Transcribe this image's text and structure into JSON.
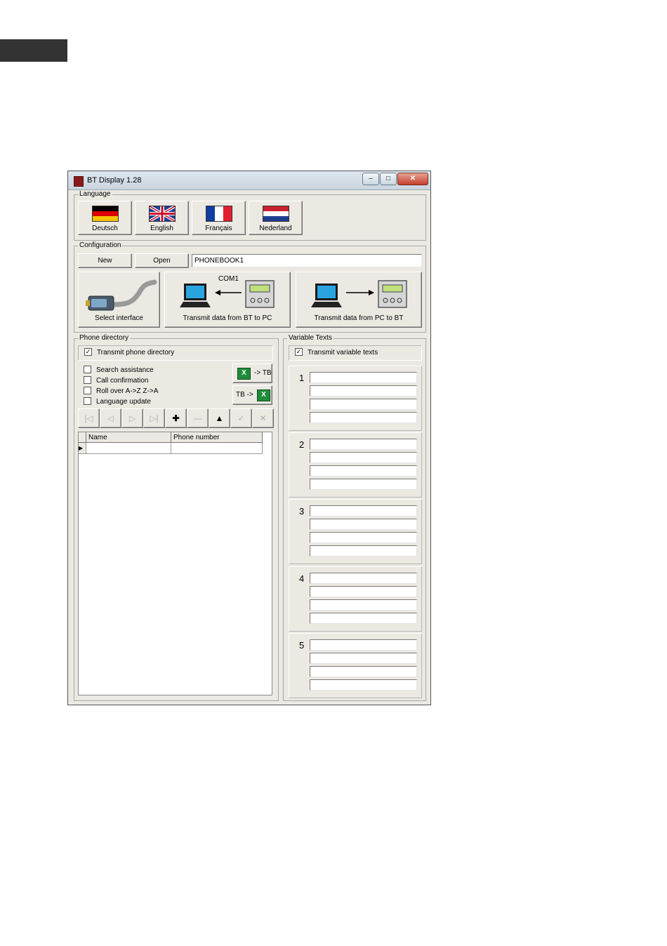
{
  "window": {
    "title": "BT Display 1.28"
  },
  "language": {
    "label": "Language",
    "buttons": [
      {
        "label": "Deutsch",
        "flag": "germany-flag"
      },
      {
        "label": "English",
        "flag": "uk-flag"
      },
      {
        "label": "Français",
        "flag": "france-flag"
      },
      {
        "label": "Nederland",
        "flag": "netherlands-flag"
      }
    ]
  },
  "configuration": {
    "label": "Configuration",
    "new_label": "New",
    "open_label": "Open",
    "file_name": "PHONEBOOK1",
    "port_label": "COM1",
    "select_interface_label": "Select interface",
    "bt_to_pc_label": "Transmit data from BT to PC",
    "pc_to_bt_label": "Transmit data from PC to BT"
  },
  "phone_directory": {
    "label": "Phone directory",
    "transmit": {
      "label": "Transmit phone directory",
      "checked": true
    },
    "options": [
      {
        "label": "Search assistance",
        "checked": false
      },
      {
        "label": "Call confirmation",
        "checked": false
      },
      {
        "label": "Roll over A->Z Z->A",
        "checked": false
      },
      {
        "label": "Language update",
        "checked": false
      }
    ],
    "excel_to_tb_label": "-> TB",
    "tb_to_excel_label": "TB ->",
    "columns": [
      "Name",
      "Phone number"
    ]
  },
  "variable_texts": {
    "label": "Variable Texts",
    "transmit": {
      "label": "Transmit variable texts",
      "checked": true
    },
    "blocks": [
      "1",
      "2",
      "3",
      "4",
      "5"
    ]
  },
  "colors": {
    "window_bg": "#ece9e3",
    "excel_green": "#1f8c3a",
    "titlebar": "#d4dee8"
  }
}
